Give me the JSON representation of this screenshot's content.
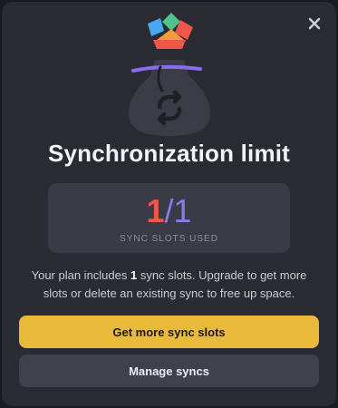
{
  "modal": {
    "title": "Synchronization limit",
    "close_icon": "close-icon"
  },
  "illustration": {
    "icon": "money-bag-sync-icon",
    "colors": {
      "bag": "#3b3c46",
      "tie": "#8b6cf0",
      "diamond_red": "#f0564a",
      "diamond_blue": "#4aa8f0",
      "diamond_green": "#4cc38a",
      "diamond_orange": "#f59a3a"
    }
  },
  "usage": {
    "used": "1",
    "separator": "/",
    "total": "1",
    "label": "SYNC SLOTS USED"
  },
  "description": {
    "prefix": "Your plan includes ",
    "count": "1",
    "suffix": " sync slots. Upgrade to get more slots or delete an existing sync to free up space."
  },
  "buttons": {
    "primary": "Get more sync slots",
    "secondary": "Manage syncs"
  },
  "colors": {
    "background": "#2a2b33",
    "accent_yellow": "#e9b93a",
    "used_red": "#f0564a",
    "total_purple": "#8b7cf0"
  }
}
